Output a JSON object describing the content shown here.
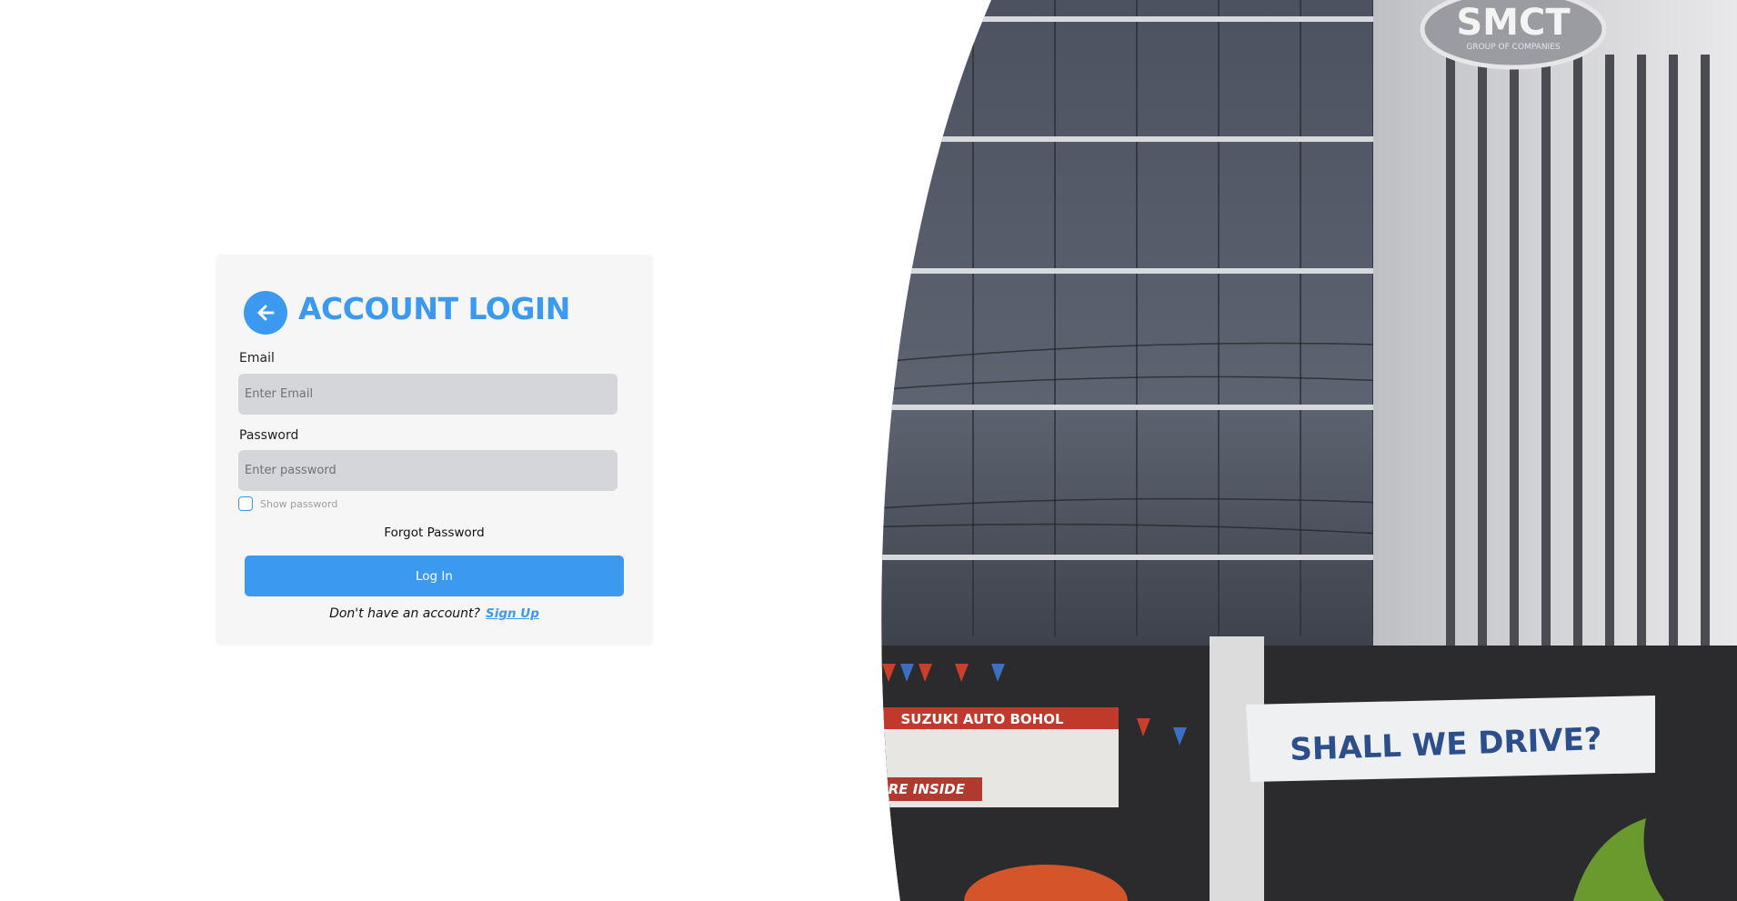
{
  "login": {
    "title": "ACCOUNT LOGIN",
    "email_label": "Email",
    "email_placeholder": "Enter Email",
    "password_label": "Password",
    "password_placeholder": "Enter password",
    "show_password_label": "Show password",
    "forgot_password_label": "Forgot Password",
    "login_button_label": "Log In",
    "signup_prompt": "Don't have an account?",
    "signup_link_label": "Sign Up"
  },
  "hero": {
    "logo_text": "SMCT",
    "logo_subtext": "GROUP OF COMPANIES",
    "banner_left": "SUZUKI AUTO BOHOL",
    "banner_left_sub": "UIRE INSIDE",
    "banner_right": "SHALL WE DRIVE?"
  },
  "colors": {
    "accent": "#3b9af0",
    "card_bg": "#f6f6f6",
    "input_bg": "#d4d6da"
  }
}
